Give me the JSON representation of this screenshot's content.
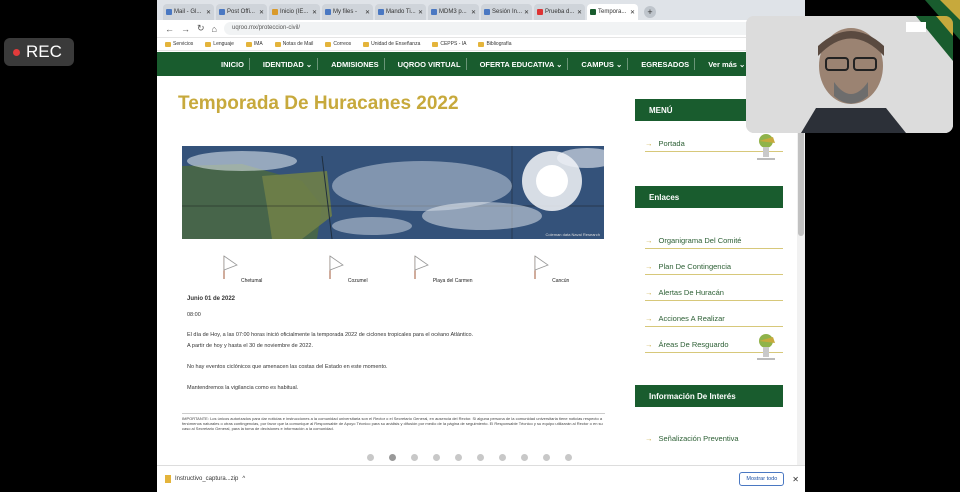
{
  "recording": {
    "label": "REC"
  },
  "browser": {
    "tabs": [
      {
        "label": "Mail - Gl..."
      },
      {
        "label": "Post Offi..."
      },
      {
        "label": "Inicio (IE..."
      },
      {
        "label": "My files -"
      },
      {
        "label": "Mando Ti..."
      },
      {
        "label": "MDM3 p..."
      },
      {
        "label": "Sesión In..."
      },
      {
        "label": "Prueba d..."
      },
      {
        "label": "Tempora..."
      }
    ],
    "new_tab": "+",
    "url": "uqroo.mx/proteccion-civil/",
    "bookmarks": [
      "Servicios",
      "Lenguaje",
      "IMA",
      "Notas de Mail",
      "Correos",
      "Unidad de Enseñanza",
      "CEPPS - IA",
      "Bibliografía"
    ]
  },
  "site_nav": {
    "items": [
      "INICIO",
      "IDENTIDAD ⌄",
      "ADMISIONES",
      "UQROO VIRTUAL",
      "OFERTA EDUCATIVA ⌄",
      "CAMPUS ⌄",
      "EGRESADOS",
      "Ver más ⌄"
    ],
    "search_icon": "search-icon"
  },
  "main": {
    "title": "Temporada De Huracanes 2022",
    "sat_credit": "Coleman data Naval Research",
    "locations": [
      "Chetumal",
      "Cozumel",
      "Playa del Carmen",
      "Cancún"
    ],
    "article": {
      "date": "Junio 01 de 2022",
      "paragraphs": [
        "08:00",
        "El día de Hoy, a las 07:00 horas inició oficialmente la temporada 2022 de ciclones tropicales para el océano Atlántico.",
        "A partir de hoy y hasta el 30 de noviembre de 2022.",
        "No hay eventos ciclónicos que amenacen las costas del Estado en este momento.",
        "Mantendremos la vigilancia como es habitual."
      ],
      "important": "IMPORTANTE: Los únicos autorizados para dar noticias e instrucciones a la comunidad universitaria son el Rector o el Secretario General, en ausencia del Rector. Si alguna persona de la comunidad universitaria tiene noticias respecto a fenómenos naturales o otras contingencias, por favor que la comunique al Responsable de Apoyo Técnico para su análisis y difusión por medio de la página de seguimiento. El Responsable Técnico y su equipo utilizarán al Rector o en su caso al Secretario General, para la toma de decisiones e información a la comunidad."
    },
    "carousel_count": 10,
    "carousel_active": 1
  },
  "sidebar": {
    "menu_title": "MENÚ",
    "menu_items": [
      "Portada"
    ],
    "links_title": "Enlaces",
    "links": [
      "Organigrama Del Comité",
      "Plan De Contingencia",
      "Alertas De Huracán",
      "Acciones A Realizar",
      "Áreas De Resguardo"
    ],
    "info_title": "Información De Interés",
    "info_items": [
      "Señalización Preventiva"
    ]
  },
  "downloads": {
    "file": "Instructivo_captura...zip",
    "chevron": "^",
    "show_all": "Mostrar todo",
    "close": "✕"
  },
  "colors": {
    "brand_green": "#195c2e",
    "gold": "#c7a93c"
  }
}
